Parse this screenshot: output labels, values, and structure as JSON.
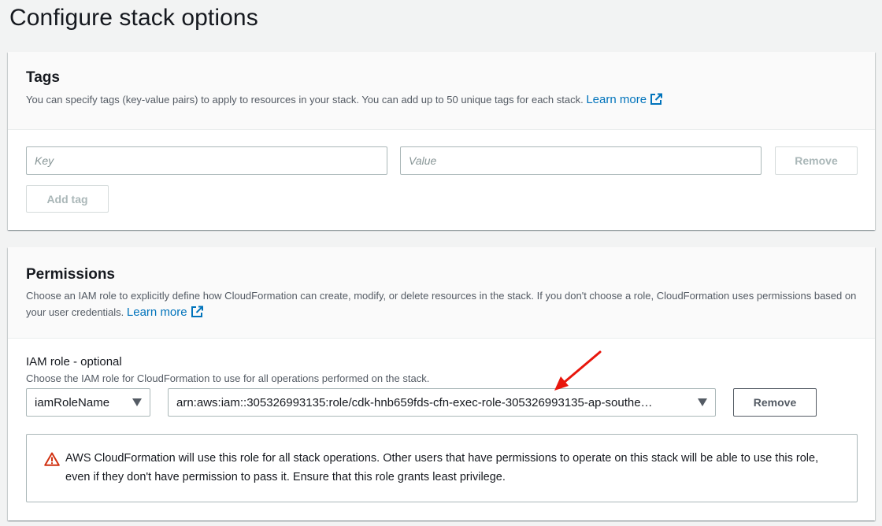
{
  "page": {
    "title": "Configure stack options"
  },
  "tags": {
    "title": "Tags",
    "description": "You can specify tags (key-value pairs) to apply to resources in your stack. You can add up to 50 unique tags for each stack.",
    "learn_more": "Learn more",
    "key_placeholder": "Key",
    "value_placeholder": "Value",
    "remove_label": "Remove",
    "add_tag_label": "Add tag"
  },
  "permissions": {
    "title": "Permissions",
    "description": "Choose an IAM role to explicitly define how CloudFormation can create, modify, or delete resources in the stack. If you don't choose a role, CloudFormation uses permissions based on your user credentials.",
    "learn_more": "Learn more",
    "iam_role_label": "IAM role - optional",
    "iam_role_hint": "Choose the IAM role for CloudFormation to use for all operations performed on the stack.",
    "role_type_selected": "iamRoleName",
    "role_arn_selected": "arn:aws:iam::305326993135:role/cdk-hnb659fds-cfn-exec-role-305326993135-ap-southe…",
    "remove_label": "Remove",
    "warning_text": "AWS CloudFormation will use this role for all stack operations. Other users that have permissions to operate on this stack will be able to use this role, even if they don't have permission to pass it. Ensure that this role grants least privilege."
  },
  "colors": {
    "link": "#0073bb",
    "warning": "#d13212",
    "annotation_arrow": "#e8160c"
  },
  "icons": {
    "external_link": "external-link-icon",
    "warning": "warning-icon",
    "caret": "caret-down-icon"
  }
}
